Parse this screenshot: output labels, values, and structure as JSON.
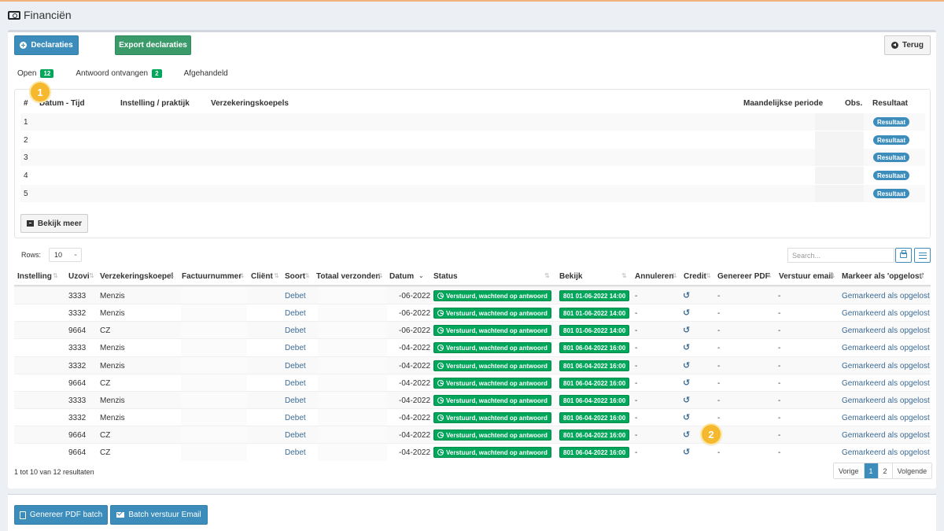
{
  "page": {
    "title": "Financiën",
    "icon": "money-icon"
  },
  "toolbar": {
    "declaraties_label": "Declaraties",
    "export_label": "Export declaraties",
    "terug_label": "Terug"
  },
  "tabs": [
    {
      "label": "Open",
      "badge": "12"
    },
    {
      "label": "Antwoord ontvangen",
      "badge": "2"
    },
    {
      "label": "Afgehandeld",
      "badge": ""
    }
  ],
  "open_table": {
    "headers": [
      "#",
      "Datum - Tijd",
      "Instelling / praktijk",
      "Verzekeringskoepels",
      "Maandelijkse periode",
      "Obs.",
      "Resultaat"
    ],
    "rows": [
      {
        "num": "1",
        "resultaat": "Resultaat"
      },
      {
        "num": "2",
        "resultaat": "Resultaat"
      },
      {
        "num": "3",
        "resultaat": "Resultaat"
      },
      {
        "num": "4",
        "resultaat": "Resultaat"
      },
      {
        "num": "5",
        "resultaat": "Resultaat"
      }
    ],
    "bekijk_meer": "Bekijk meer"
  },
  "markers": {
    "one": "1",
    "two": "2"
  },
  "controls": {
    "rows_label": "Rows:",
    "rows_value": "10",
    "search_placeholder": "Search..."
  },
  "main_table": {
    "headers": [
      "Instelling",
      "Uzovi",
      "Verzekeringskoepel",
      "Factuurnummer",
      "Cliënt",
      "Soort",
      "Totaal verzonden",
      "Datum",
      "Status",
      "Bekijk",
      "Annuleren",
      "Credit",
      "Genereer PDF",
      "Verstuur email",
      "Markeer als 'opgelost'"
    ],
    "rows": [
      {
        "uzovi": "3333",
        "koepel": "Menzis",
        "soort": "Debet",
        "datum": "-06-2022",
        "status": "Verstuurd, wachtend op antwoord",
        "bekijk": "801 01-06-2022 14:00",
        "annuleren": "-",
        "pdf": "-",
        "email": "-",
        "markeer": "Gemarkeerd als opgelost"
      },
      {
        "uzovi": "3332",
        "koepel": "Menzis",
        "soort": "Debet",
        "datum": "-06-2022",
        "status": "Verstuurd, wachtend op antwoord",
        "bekijk": "801 01-06-2022 14:00",
        "annuleren": "-",
        "pdf": "-",
        "email": "-",
        "markeer": "Gemarkeerd als opgelost"
      },
      {
        "uzovi": "9664",
        "koepel": "CZ",
        "soort": "Debet",
        "datum": "-06-2022",
        "status": "Verstuurd, wachtend op antwoord",
        "bekijk": "801 01-06-2022 14:00",
        "annuleren": "-",
        "pdf": "-",
        "email": "-",
        "markeer": "Gemarkeerd als opgelost"
      },
      {
        "uzovi": "3333",
        "koepel": "Menzis",
        "soort": "Debet",
        "datum": "-04-2022",
        "status": "Verstuurd, wachtend op antwoord",
        "bekijk": "801 06-04-2022 16:00",
        "annuleren": "-",
        "pdf": "-",
        "email": "-",
        "markeer": "Gemarkeerd als opgelost"
      },
      {
        "uzovi": "3332",
        "koepel": "Menzis",
        "soort": "Debet",
        "datum": "-04-2022",
        "status": "Verstuurd, wachtend op antwoord",
        "bekijk": "801 06-04-2022 16:00",
        "annuleren": "-",
        "pdf": "-",
        "email": "-",
        "markeer": "Gemarkeerd als opgelost"
      },
      {
        "uzovi": "9664",
        "koepel": "CZ",
        "soort": "Debet",
        "datum": "-04-2022",
        "status": "Verstuurd, wachtend op antwoord",
        "bekijk": "801 06-04-2022 16:00",
        "annuleren": "-",
        "pdf": "-",
        "email": "-",
        "markeer": "Gemarkeerd als opgelost"
      },
      {
        "uzovi": "3333",
        "koepel": "Menzis",
        "soort": "Debet",
        "datum": "-04-2022",
        "status": "Verstuurd, wachtend op antwoord",
        "bekijk": "801 06-04-2022 16:00",
        "annuleren": "-",
        "pdf": "-",
        "email": "-",
        "markeer": "Gemarkeerd als opgelost"
      },
      {
        "uzovi": "3332",
        "koepel": "Menzis",
        "soort": "Debet",
        "datum": "-04-2022",
        "status": "Verstuurd, wachtend op antwoord",
        "bekijk": "801 06-04-2022 16:00",
        "annuleren": "-",
        "pdf": "-",
        "email": "-",
        "markeer": "Gemarkeerd als opgelost"
      },
      {
        "uzovi": "9664",
        "koepel": "CZ",
        "soort": "Debet",
        "datum": "-04-2022",
        "status": "Verstuurd, wachtend op antwoord",
        "bekijk": "801 06-04-2022 16:00",
        "annuleren": "-",
        "pdf": "-",
        "email": "-",
        "markeer": "Gemarkeerd als opgelost"
      },
      {
        "uzovi": "9664",
        "koepel": "CZ",
        "soort": "Debet",
        "datum": "-04-2022",
        "status": "Verstuurd, wachtend op antwoord",
        "bekijk": "801 06-04-2022 16:00",
        "annuleren": "-",
        "pdf": "-",
        "email": "-",
        "markeer": "Gemarkeerd als opgelost"
      }
    ]
  },
  "pagination": {
    "summary": "1 tot 10 van 12 resultaten",
    "prev": "Vorige",
    "pages": [
      "1",
      "2"
    ],
    "next": "Volgende"
  },
  "footer": {
    "pdf_batch_label": "Genereer PDF batch",
    "email_batch_label": "Batch verstuur Email"
  },
  "colors": {
    "primary": "#3c8dbc",
    "success": "#00a65a",
    "marker": "#f5b82e"
  }
}
